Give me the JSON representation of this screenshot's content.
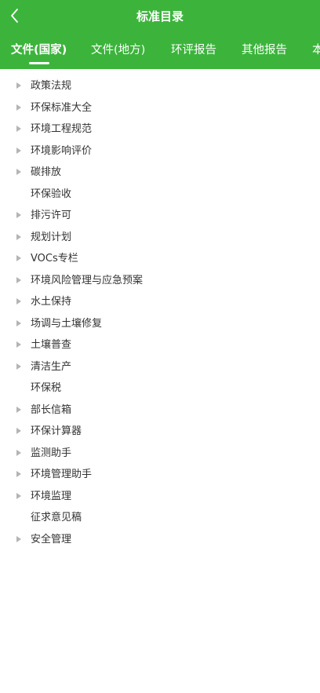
{
  "header": {
    "title": "标准目录",
    "back_icon": "chevron-left-icon",
    "bg_color": "#3cb43c"
  },
  "tabs": [
    {
      "label": "文件(国家)",
      "active": true
    },
    {
      "label": "文件(地方)",
      "active": false
    },
    {
      "label": "环评报告",
      "active": false
    },
    {
      "label": "其他报告",
      "active": false
    },
    {
      "label": "本",
      "active": false
    }
  ],
  "list": [
    {
      "label": "政策法规",
      "expandable": true
    },
    {
      "label": "环保标准大全",
      "expandable": true
    },
    {
      "label": "环境工程规范",
      "expandable": true
    },
    {
      "label": "环境影响评价",
      "expandable": true
    },
    {
      "label": "碳排放",
      "expandable": true
    },
    {
      "label": "环保验收",
      "expandable": false
    },
    {
      "label": "排污许可",
      "expandable": true
    },
    {
      "label": "规划计划",
      "expandable": true
    },
    {
      "label": "VOCs专栏",
      "expandable": true
    },
    {
      "label": "环境风险管理与应急预案",
      "expandable": true
    },
    {
      "label": "水土保持",
      "expandable": true
    },
    {
      "label": "场调与土壤修复",
      "expandable": true
    },
    {
      "label": "土壤普查",
      "expandable": true
    },
    {
      "label": "清洁生产",
      "expandable": true
    },
    {
      "label": "环保税",
      "expandable": false
    },
    {
      "label": "部长信箱",
      "expandable": true
    },
    {
      "label": "环保计算器",
      "expandable": true
    },
    {
      "label": "监测助手",
      "expandable": true
    },
    {
      "label": "环境管理助手",
      "expandable": true
    },
    {
      "label": "环境监理",
      "expandable": true
    },
    {
      "label": "征求意见稿",
      "expandable": false
    },
    {
      "label": "安全管理",
      "expandable": true
    }
  ]
}
